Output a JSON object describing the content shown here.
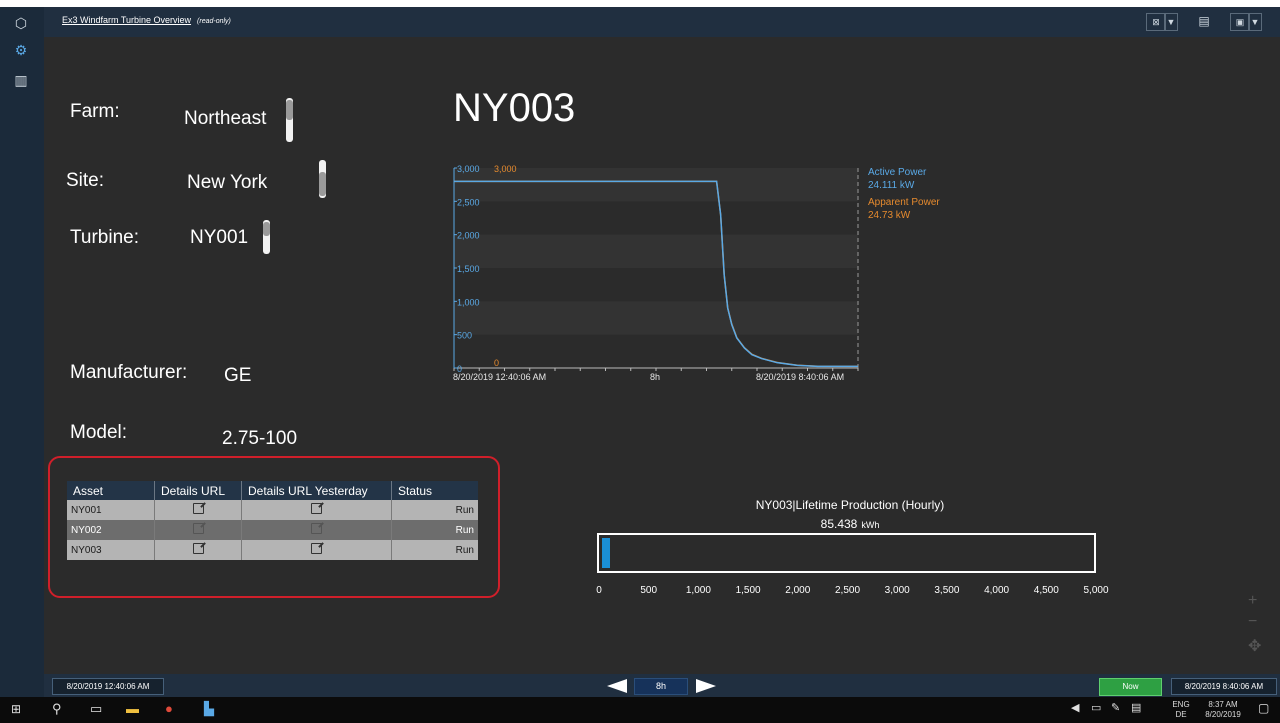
{
  "window": {
    "title": "Ex3 Windfarm Turbine Overview",
    "readonly": "(read-only)"
  },
  "left_icons": [
    "cube-icon",
    "dashboard-icon",
    "library-icon"
  ],
  "toolbar": {
    "dropdown_glyph": "▼",
    "save_glyph": "💾"
  },
  "fields": {
    "farm": {
      "label": "Farm:",
      "value": "Northeast"
    },
    "site": {
      "label": "Site:",
      "value": "New York"
    },
    "turbine": {
      "label": "Turbine:",
      "value": "NY001"
    },
    "manufacturer": {
      "label": "Manufacturer:",
      "value": "GE"
    },
    "model": {
      "label": "Model:",
      "value": "2.75-100"
    }
  },
  "asset_title": "NY003",
  "chart_data": {
    "type": "line",
    "x_start": "8/20/2019 12:40:06 AM",
    "x_end": "8/20/2019 8:40:06 AM",
    "x_span": "8h",
    "y_ticks": [
      "0",
      "500",
      "1,000",
      "1,500",
      "2,000",
      "2,500",
      "3,000"
    ],
    "ylim": [
      0,
      3000
    ],
    "secondary_ymax": "3,000",
    "secondary_ymin": "0",
    "series": [
      {
        "name": "Active Power",
        "value": "24.111 kW",
        "color": "#5aa9e6",
        "x": [
          0,
          5.2,
          5.28,
          5.35,
          5.42,
          5.5,
          5.6,
          5.75,
          5.9,
          6.1,
          6.4,
          6.8,
          7.2,
          8.0
        ],
        "y": [
          2800,
          2800,
          2300,
          1400,
          900,
          650,
          450,
          300,
          200,
          140,
          80,
          40,
          25,
          24
        ]
      },
      {
        "name": "Apparent Power",
        "value": "24.73 kW",
        "color": "#e58a2e",
        "x": [
          0,
          5.2,
          5.28,
          5.35,
          5.42,
          5.5,
          5.6,
          5.75,
          5.9,
          6.1,
          6.4,
          6.8,
          7.2,
          8.0
        ],
        "y": [
          2800,
          2800,
          2300,
          1400,
          900,
          660,
          455,
          305,
          205,
          142,
          82,
          41,
          26,
          25
        ]
      }
    ]
  },
  "table": {
    "headers": [
      "Asset",
      "Details URL",
      "Details URL Yesterday",
      "Status"
    ],
    "rows": [
      {
        "asset": "NY001",
        "status": "Run"
      },
      {
        "asset": "NY002",
        "status": "Run"
      },
      {
        "asset": "NY003",
        "status": "Run"
      }
    ]
  },
  "production": {
    "title": "NY003|Lifetime Production (Hourly)",
    "value": "85.438",
    "unit": "kWh",
    "max": 5000,
    "fill_value": 85.438,
    "ticks": [
      "0",
      "500",
      "1,000",
      "1,500",
      "2,000",
      "2,500",
      "3,000",
      "3,500",
      "4,000",
      "4,500",
      "5,000"
    ]
  },
  "timebar": {
    "start": "8/20/2019 12:40:06 AM",
    "end": "8/20/2019 8:40:06 AM",
    "duration": "8h",
    "now_label": "Now"
  },
  "system_tray": {
    "lang": "ENG",
    "region": "DE",
    "time": "8:37 AM",
    "date": "8/20/2019"
  }
}
